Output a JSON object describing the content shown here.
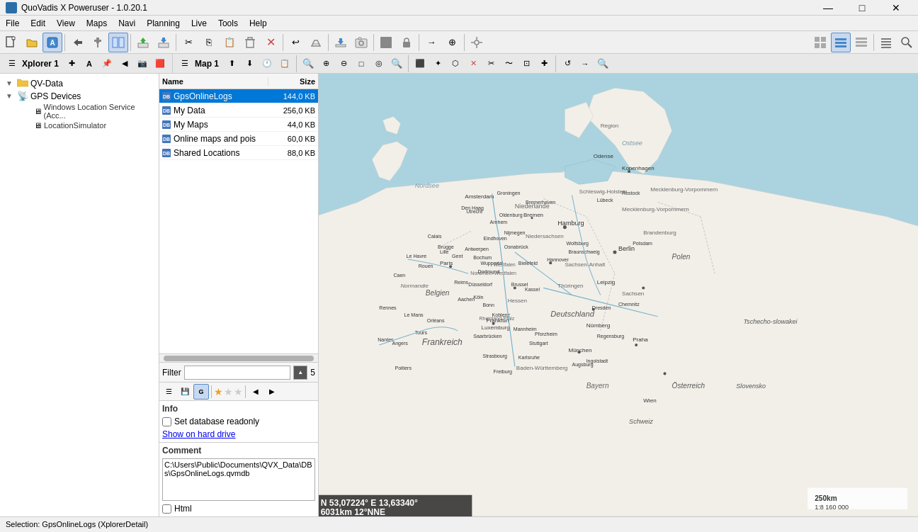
{
  "titlebar": {
    "title": "QuoVadis X Poweruser - 1.0.20.1",
    "controls": [
      "—",
      "□",
      "✕"
    ]
  },
  "menubar": {
    "items": [
      "File",
      "Edit",
      "View",
      "Maps",
      "Navi",
      "Planning",
      "Live",
      "Tools",
      "Help"
    ]
  },
  "xplorer": {
    "tab_label": "Xplorer 1"
  },
  "map": {
    "tab_label": "Map 1"
  },
  "tree": {
    "items": [
      {
        "label": "QV-Data",
        "level": 0,
        "type": "folder",
        "expanded": true
      },
      {
        "label": "GPS Devices",
        "level": 0,
        "type": "gps",
        "expanded": true
      },
      {
        "label": "Windows Location Service (Acc...",
        "level": 1,
        "type": "device"
      },
      {
        "label": "LocationSimulator",
        "level": 1,
        "type": "device"
      }
    ]
  },
  "file_list": {
    "columns": [
      {
        "label": "Name",
        "key": "name"
      },
      {
        "label": "Size",
        "key": "size"
      }
    ],
    "items": [
      {
        "name": "GpsOnlineLogs",
        "size": "144,0 KB",
        "selected": true
      },
      {
        "name": "My Data",
        "size": "256,0 KB"
      },
      {
        "name": "My Maps",
        "size": "44,0 KB"
      },
      {
        "name": "Online maps and pois",
        "size": "60,0 KB"
      },
      {
        "name": "Shared Locations",
        "size": "88,0 KB"
      }
    ]
  },
  "filter": {
    "label": "Filter",
    "value": "",
    "count": "5"
  },
  "info": {
    "tab_label": "Info",
    "readonly_label": "Set database readonly",
    "show_hard_drive_label": "Show on hard drive"
  },
  "comment": {
    "label": "Comment",
    "text": "C:\\Users\\Public\\Documents\\QVX_Data\\DBs\\GpsOnlineLogs.qvmdb",
    "html_label": "Html"
  },
  "map_area": {
    "coord": "N 53,07224° E 13,63340°",
    "distance": "6031km 12°NNE",
    "zoom": "250km",
    "scale": "1:8 160 000"
  },
  "status_bar": {
    "text": "Selection: GpsOnlineLogs   (XplorerDetail)"
  },
  "toolbar": {
    "buttons": [
      {
        "icon": "⟲",
        "name": "new"
      },
      {
        "icon": "✚",
        "name": "open"
      },
      {
        "icon": "💾",
        "name": "save"
      },
      {
        "icon": "✎",
        "name": "edit"
      },
      {
        "icon": "⊕",
        "name": "add"
      },
      {
        "icon": "📁",
        "name": "folder"
      },
      {
        "icon": "📤",
        "name": "export"
      },
      {
        "icon": "🖨",
        "name": "print"
      },
      {
        "icon": "✂",
        "name": "cut"
      },
      {
        "icon": "⎘",
        "name": "copy"
      },
      {
        "icon": "📋",
        "name": "paste"
      },
      {
        "icon": "🗑",
        "name": "delete"
      },
      {
        "icon": "✕",
        "name": "close"
      },
      {
        "icon": "↩",
        "name": "undo"
      },
      {
        "icon": "🗑",
        "name": "clear"
      },
      {
        "icon": "⬇",
        "name": "download"
      },
      {
        "icon": "📷",
        "name": "capture"
      },
      {
        "icon": "⬛",
        "name": "black"
      },
      {
        "icon": "🔒",
        "name": "lock"
      },
      {
        "icon": "→",
        "name": "forward"
      },
      {
        "icon": "⊕",
        "name": "plus"
      },
      {
        "icon": "⚙",
        "name": "settings"
      },
      {
        "icon": "🔍",
        "name": "search"
      }
    ]
  },
  "map_toolbar": {
    "buttons": [
      {
        "icon": "⊕",
        "name": "layers-up"
      },
      {
        "icon": "⊖",
        "name": "layers-down"
      },
      {
        "icon": "🕐",
        "name": "time"
      },
      {
        "icon": "📋",
        "name": "copy-map"
      },
      {
        "icon": "🔍+",
        "name": "zoom-in-btn"
      },
      {
        "icon": "⊕",
        "name": "zoom-plus"
      },
      {
        "icon": "⊖",
        "name": "zoom-minus"
      },
      {
        "icon": "□",
        "name": "zoom-rect"
      },
      {
        "icon": "◎",
        "name": "zoom-circle"
      },
      {
        "icon": "🔍",
        "name": "zoom-fit"
      },
      {
        "icon": "⬛",
        "name": "select-rect"
      },
      {
        "icon": "✦",
        "name": "select-star"
      },
      {
        "icon": "⬡",
        "name": "filter-shape"
      },
      {
        "icon": "✕",
        "name": "delete-map"
      },
      {
        "icon": "✂",
        "name": "cut-map"
      },
      {
        "icon": "~",
        "name": "wave"
      },
      {
        "icon": "⊡",
        "name": "box-select"
      },
      {
        "icon": "✚",
        "name": "cross"
      },
      {
        "icon": "↺",
        "name": "refresh-map"
      },
      {
        "icon": "→",
        "name": "route"
      },
      {
        "icon": "🔍",
        "name": "find"
      }
    ]
  },
  "colors": {
    "selected_row_bg": "#0078d7",
    "header_bg": "#e8e8e8",
    "toolbar_bg": "#f0f0f0",
    "accent": "#2a6ea8"
  }
}
